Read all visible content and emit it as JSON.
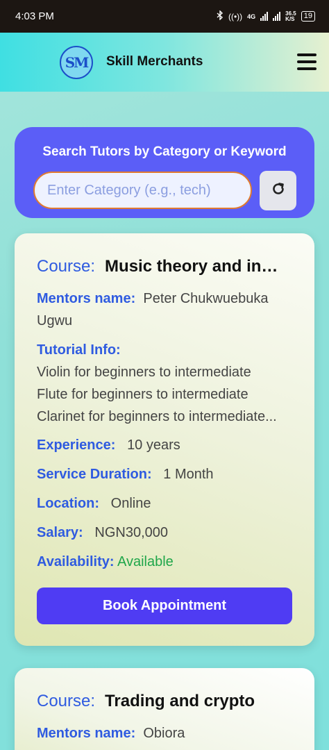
{
  "status_bar": {
    "time": "4:03 PM",
    "network_label": "4G",
    "speed_value": "36.5",
    "speed_unit": "K/S",
    "battery": "19"
  },
  "header": {
    "logo_text": "SM",
    "brand_name": "Skill Merchants",
    "menu_icon": "hamburger-menu-icon"
  },
  "search": {
    "title": "Search Tutors by Category or Keyword",
    "placeholder": "Enter Category (e.g., tech)",
    "refresh_icon": "refresh-icon"
  },
  "labels": {
    "course": "Course:",
    "mentor": "Mentors name:",
    "tutorial": "Tutorial Info:",
    "experience": "Experience:",
    "duration": "Service Duration:",
    "location": "Location:",
    "salary": "Salary:",
    "availability": "Availability:",
    "book": "Book Appointment"
  },
  "tutors": [
    {
      "course": "Music theory and instruments",
      "mentor": "Peter Chukwuebuka Ugwu",
      "tutorial_lines": [
        "Violin for beginners to intermediate",
        "Flute for beginners to intermediate",
        "Clarinet for beginners to intermediate..."
      ],
      "experience": "10 years",
      "duration": "1 Month",
      "location": "Online",
      "salary": "NGN30,000",
      "availability": "Available"
    },
    {
      "course": "Trading and crypto",
      "mentor": "Obiora"
    }
  ],
  "colors": {
    "accent": "#2f5be0",
    "button": "#4f3cf3",
    "search_panel": "#5b5ef7",
    "available": "#1fa64a"
  }
}
